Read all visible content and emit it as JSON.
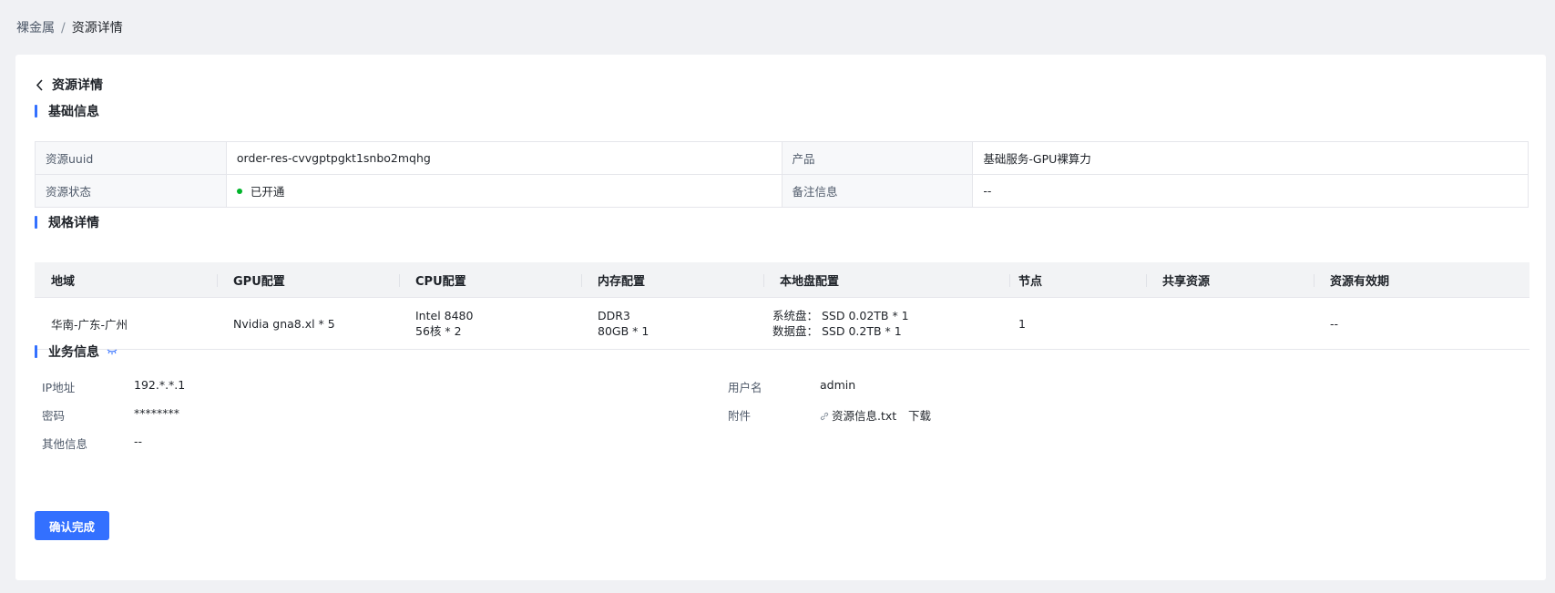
{
  "breadcrumb": {
    "parent": "裸金属",
    "separator": "/",
    "current": "资源详情"
  },
  "page": {
    "back_title": "资源详情"
  },
  "sections": {
    "basic": "基础信息",
    "spec": "规格详情",
    "business": "业务信息"
  },
  "basic_info": {
    "uuid_label": "资源uuid",
    "uuid_value": "order-res-cvvgptpgkt1snbo2mqhg",
    "product_label": "产品",
    "product_value": "基础服务-GPU裸算力",
    "status_label": "资源状态",
    "status_value": "已开通",
    "remark_label": "备注信息",
    "remark_value": "--"
  },
  "spec_table": {
    "headers": [
      "地域",
      "GPU配置",
      "CPU配置",
      "内存配置",
      "本地盘配置",
      "节点",
      "共享资源",
      "资源有效期"
    ],
    "row": {
      "region": "华南-广东-广州",
      "gpu": "Nvidia gna8.xl *  5",
      "cpu_line1": "Intel 8480",
      "cpu_line2": "56核 * 2",
      "mem_line1": "DDR3",
      "mem_line2": "80GB * 1",
      "disk_line1": "系统盘：  SSD 0.02TB * 1",
      "disk_line2": "数据盘：  SSD 0.2TB * 1",
      "nodes": "1",
      "shared": "",
      "validity": "--"
    }
  },
  "business_info": {
    "ip_label": "IP地址",
    "ip_value": "192.*.*.1",
    "user_label": "用户名",
    "user_value": "admin",
    "pwd_label": "密码",
    "pwd_value": "********",
    "attach_label": "附件",
    "attach_file": "资源信息.txt",
    "attach_download": "下载",
    "other_label": "其他信息",
    "other_value": "--"
  },
  "actions": {
    "confirm": "确认完成"
  },
  "colors": {
    "primary": "#3370ff",
    "success": "#00b42a"
  },
  "icons": [
    "back-arrow-icon",
    "eye-closed-icon",
    "attachment-link-icon"
  ]
}
